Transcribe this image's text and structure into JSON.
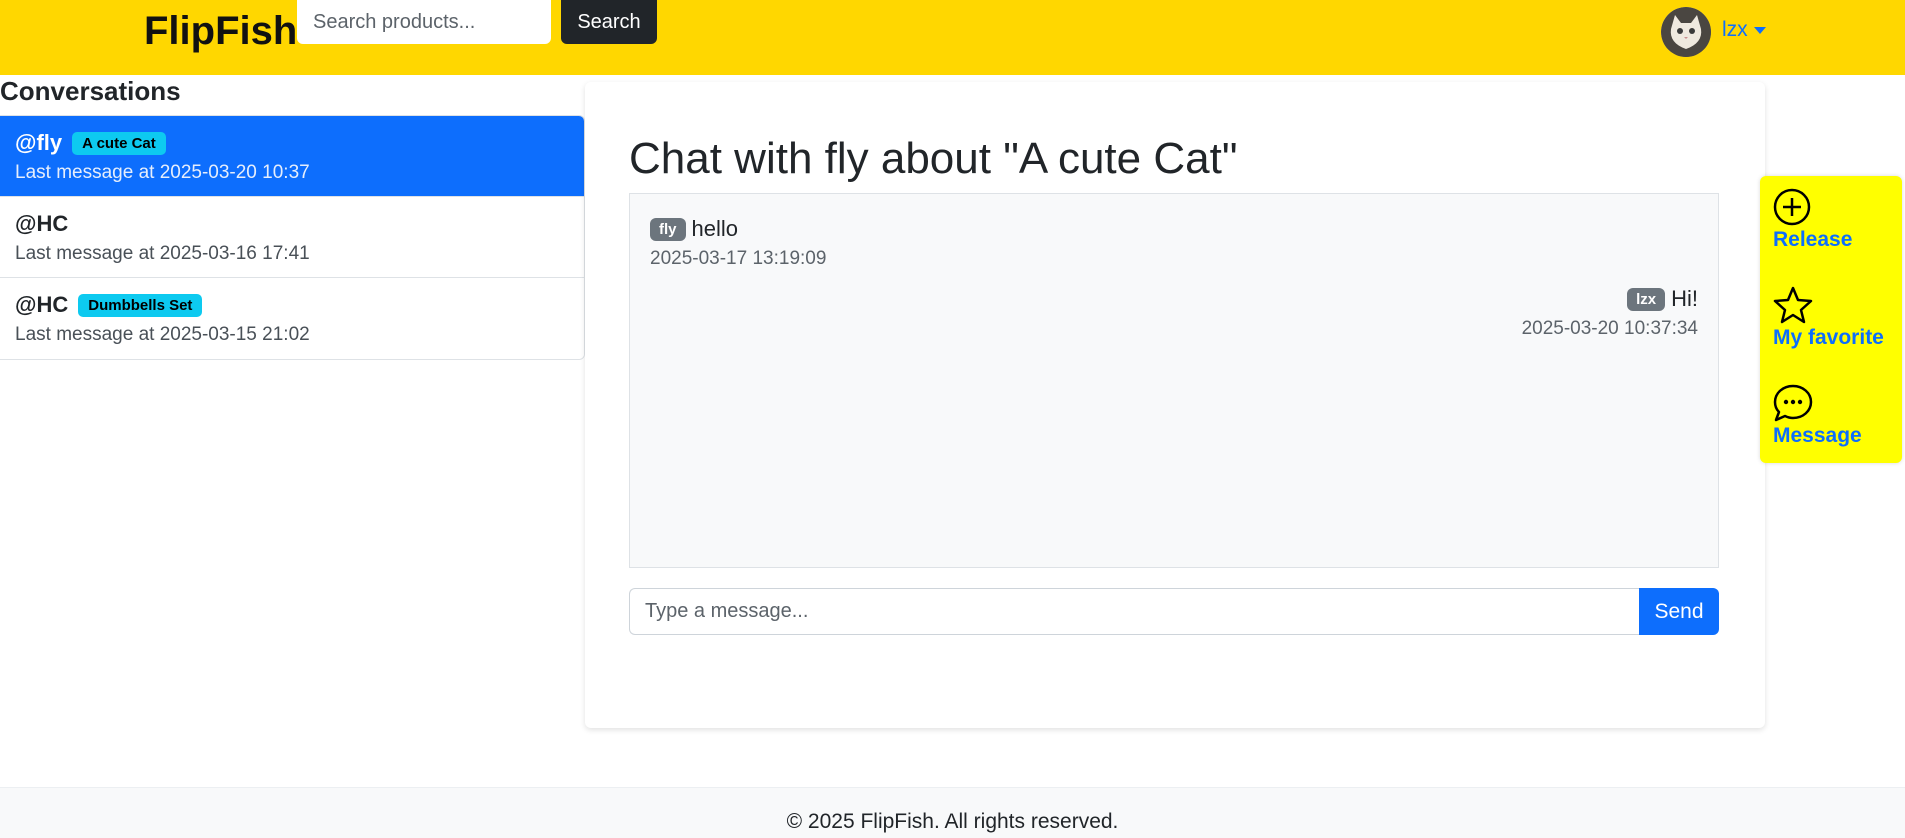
{
  "header": {
    "brand": "FlipFish",
    "search_placeholder": "Search products...",
    "search_button": "Search",
    "username": "lzx"
  },
  "sidebar": {
    "heading": "Conversations",
    "conversations": [
      {
        "user": "@fly",
        "badge": "A cute Cat",
        "last_message": "Last message at 2025-03-20 10:37",
        "active": true
      },
      {
        "user": "@HC",
        "badge": "",
        "last_message": "Last message at 2025-03-16 17:41",
        "active": false
      },
      {
        "user": "@HC",
        "badge": "Dumbbells Set",
        "last_message": "Last message at 2025-03-15 21:02",
        "active": false
      }
    ]
  },
  "chat": {
    "title": "Chat with fly about \"A cute Cat\"",
    "messages": [
      {
        "sender": "fly",
        "text": "hello",
        "time": "2025-03-17 13:19:09",
        "side": "left"
      },
      {
        "sender": "lzx",
        "text": "Hi!",
        "time": "2025-03-20 10:37:34",
        "side": "right"
      }
    ],
    "input_placeholder": "Type a message...",
    "send_button": "Send"
  },
  "side_panel": {
    "items": [
      {
        "label": "Release",
        "icon": "plus-circle-icon"
      },
      {
        "label": "My favorite",
        "icon": "star-icon"
      },
      {
        "label": "Message",
        "icon": "chat-dots-icon"
      }
    ]
  },
  "footer": {
    "text": "© 2025 FlipFish. All rights reserved."
  },
  "colors": {
    "navbar": "#ffd700",
    "primary": "#0d6efd",
    "badge_info": "#0dcaf0",
    "badge_secondary": "#6c757d",
    "side_panel": "#ffff00"
  }
}
